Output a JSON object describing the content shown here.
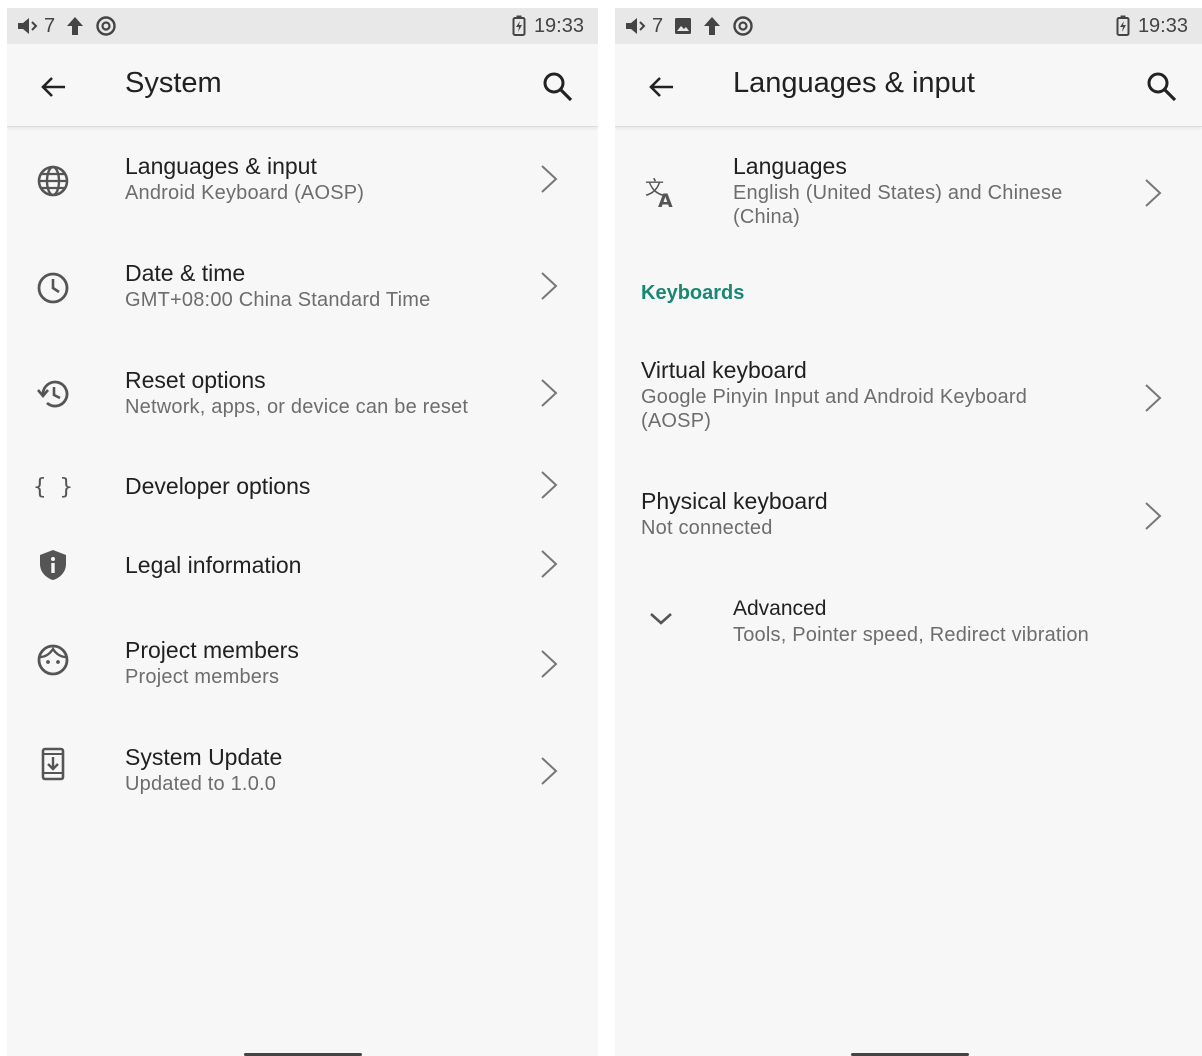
{
  "left": {
    "status": {
      "volume_num": "7",
      "time": "19:33"
    },
    "appbar": {
      "title": "System"
    },
    "items": [
      {
        "title": "Languages & input",
        "subtitle": "Android Keyboard (AOSP)",
        "icon": "globe-icon"
      },
      {
        "title": "Date & time",
        "subtitle": "GMT+08:00 China Standard Time",
        "icon": "clock-icon"
      },
      {
        "title": "Reset options",
        "subtitle": "Network, apps, or device can be reset",
        "icon": "restore-icon"
      },
      {
        "title": "Developer options",
        "icon": "braces-icon"
      },
      {
        "title": "Legal information",
        "icon": "shield-info-icon"
      },
      {
        "title": "Project members",
        "subtitle": "Project members",
        "icon": "face-icon"
      },
      {
        "title": "System Update",
        "subtitle": "Updated to  1.0.0",
        "icon": "system-update-icon"
      }
    ]
  },
  "right": {
    "status": {
      "volume_num": "7",
      "time": "19:33"
    },
    "appbar": {
      "title": "Languages & input"
    },
    "languages": {
      "title": "Languages",
      "subtitle_line1": "English (United States) and Chinese",
      "subtitle_line2": "(China)",
      "icon": "translate-icon"
    },
    "keyboards_header": "Keyboards",
    "virtual_keyboard": {
      "title": "Virtual keyboard",
      "subtitle_line1": "Google Pinyin Input and Android Keyboard",
      "subtitle_line2": "(AOSP)"
    },
    "physical_keyboard": {
      "title": "Physical keyboard",
      "subtitle": "Not connected"
    },
    "advanced": {
      "title": "Advanced",
      "subtitle": "Tools, Pointer speed, Redirect vibration",
      "icon": "chevron-down-icon"
    }
  },
  "colors": {
    "accent": "#1a8774",
    "background": "#f7f7f7",
    "statusbar": "#e8e8e8"
  }
}
